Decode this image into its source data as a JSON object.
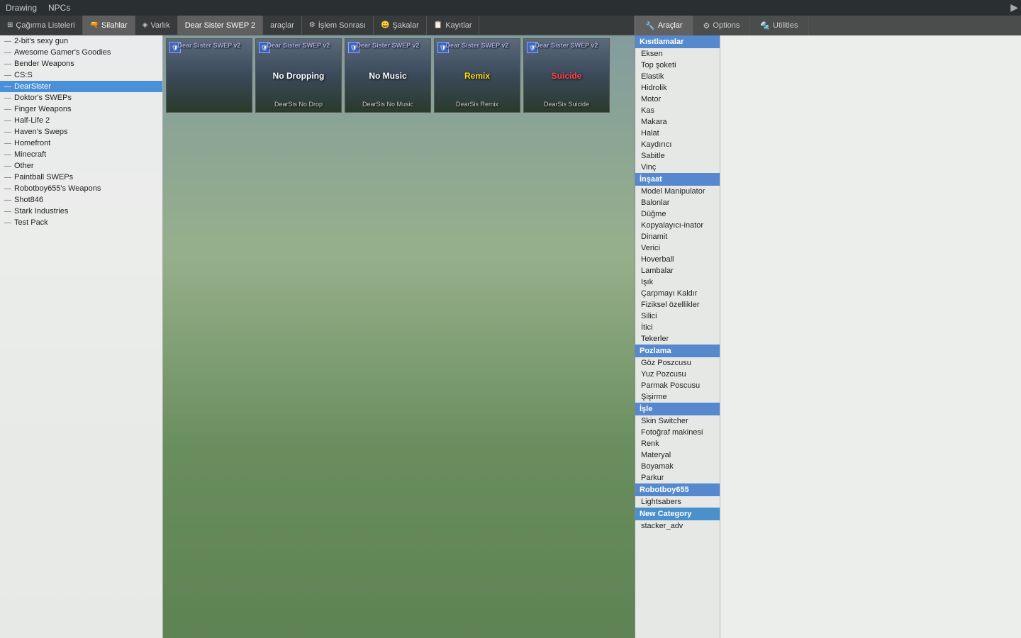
{
  "menubar": {
    "items": [
      "Drawing",
      "NPCs"
    ],
    "expand_icon": "▶"
  },
  "tabs": [
    {
      "label": "Çağırma Listeleri",
      "icon": "⊞",
      "active": false
    },
    {
      "label": "Silahlar",
      "icon": "🔫",
      "active": true
    },
    {
      "label": "Varlık",
      "icon": "📦",
      "active": false
    },
    {
      "label": "Dear Sister SWEP 2",
      "icon": "",
      "active": true
    },
    {
      "label": "araçlar",
      "icon": "",
      "active": false
    },
    {
      "label": "İşlem Sonrası",
      "icon": "⚙",
      "active": false
    },
    {
      "label": "Şakalar",
      "icon": "😄",
      "active": false
    },
    {
      "label": "Kayıtlar",
      "icon": "📋",
      "active": false
    }
  ],
  "sidebar": {
    "items": [
      {
        "label": "2-bit's sexy gun",
        "selected": false
      },
      {
        "label": "Awesome Gamer's Goodies",
        "selected": false
      },
      {
        "label": "Bender Weapons",
        "selected": false
      },
      {
        "label": "CS:S",
        "selected": false
      },
      {
        "label": "DearSister",
        "selected": true
      },
      {
        "label": "Doktor's SWEPs",
        "selected": false
      },
      {
        "label": "Finger Weapons",
        "selected": false
      },
      {
        "label": "Half-Life 2",
        "selected": false
      },
      {
        "label": "Haven's Sweps",
        "selected": false
      },
      {
        "label": "Homefront",
        "selected": false
      },
      {
        "label": "Minecraft",
        "selected": false
      },
      {
        "label": "Other",
        "selected": false
      },
      {
        "label": "Paintball SWEPs",
        "selected": false
      },
      {
        "label": "Robotboy655's Weapons",
        "selected": false
      },
      {
        "label": "Shot846",
        "selected": false
      },
      {
        "label": "Stark Industries",
        "selected": false
      },
      {
        "label": "Test Pack",
        "selected": false
      }
    ]
  },
  "weapon_cards": [
    {
      "title": "Dear Sister SWEP v2",
      "label": "",
      "name": "",
      "color": "normal"
    },
    {
      "title": "Dear Sister SWEP v2",
      "label": "DearSis No Drop",
      "name": "No Dropping",
      "color": "normal"
    },
    {
      "title": "Dear Sister SWEP v2",
      "label": "DearSis No Music",
      "name": "No Music",
      "color": "normal"
    },
    {
      "title": "Dear Sister SWEP v2",
      "label": "DearSis Remix",
      "name": "Remix",
      "color": "yellow"
    },
    {
      "title": "Dear Sister SWEP v2",
      "label": "DearSis Suicide",
      "name": "Suicide",
      "color": "red"
    }
  ],
  "right_panel": {
    "tabs": [
      {
        "label": "Araçlar",
        "icon": "🔧",
        "active": true
      },
      {
        "label": "Options",
        "icon": "⚙",
        "active": false
      },
      {
        "label": "Utilities",
        "icon": "🔩",
        "active": false
      }
    ],
    "categories": [
      {
        "name": "Kısıtlamalar",
        "items": [
          "Eksen",
          "Top şoketi",
          "Elastik",
          "Hidrolik",
          "Motor",
          "Kas",
          "Makara",
          "Halat",
          "Kaydırıcı",
          "Sabitle",
          "Vinç"
        ]
      },
      {
        "name": "İnşaat",
        "items": [
          "Model Manipulator",
          "Balonlar",
          "Düğme",
          "Kopyalayıcı-inator",
          "Dinamit",
          "Verici",
          "Hoverball",
          "Lambalar",
          "Işık",
          "Çarpmayı Kaldır",
          "Fiziksel özellikler",
          "Silici",
          "İtici",
          "Tekerler"
        ]
      },
      {
        "name": "Pozlama",
        "items": [
          "Göz Poszcusu",
          "Yuz Pozcusu",
          "Parmak Poscusu",
          "Şişirme"
        ]
      },
      {
        "name": "İşle",
        "items": [
          "Skin Switcher",
          "Fotoğraf makinesi",
          "Renk",
          "Materyal",
          "Boyamak",
          "Parkur"
        ]
      },
      {
        "name": "Robotboy655",
        "items": [
          "Lightsabers"
        ]
      },
      {
        "name": "New Category",
        "items": [
          "stacker_adv"
        ]
      }
    ]
  }
}
